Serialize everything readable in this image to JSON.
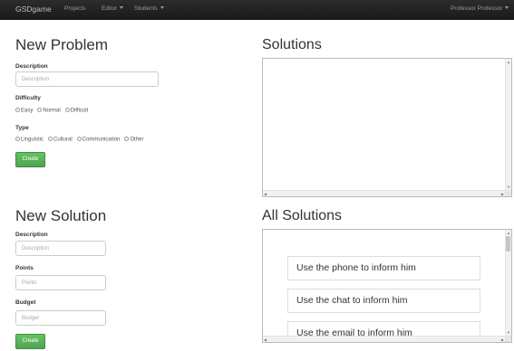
{
  "navbar": {
    "brand": "GSDgame",
    "items": [
      {
        "label": "Projects",
        "has_caret": false
      },
      {
        "label": "Editor",
        "has_caret": true
      },
      {
        "label": "Students",
        "has_caret": true
      }
    ],
    "user": "Professor Professor"
  },
  "new_problem": {
    "title": "New Problem",
    "description_label": "Description",
    "description_placeholder": "Description",
    "difficulty_label": "Difficulty",
    "difficulty_options": [
      "Easy",
      "Normal",
      "Difficult"
    ],
    "type_label": "Type",
    "type_options": [
      "Linguistic",
      "Cultural",
      "Communication",
      "Other"
    ],
    "create_label": "Create"
  },
  "solutions": {
    "title": "Solutions"
  },
  "new_solution": {
    "title": "New Solution",
    "description_label": "Description",
    "description_placeholder": "Description",
    "points_label": "Points",
    "points_placeholder": "Points",
    "budget_label": "Budget",
    "budget_placeholder": "Budget",
    "create_label": "Create"
  },
  "all_solutions": {
    "title": "All Solutions",
    "items": [
      "Use the phone to inform him",
      "Use the chat to inform him",
      "Use the email to inform him"
    ]
  },
  "colors": {
    "navbar": "#1f1f1f",
    "create_button": "#5bb75b"
  }
}
